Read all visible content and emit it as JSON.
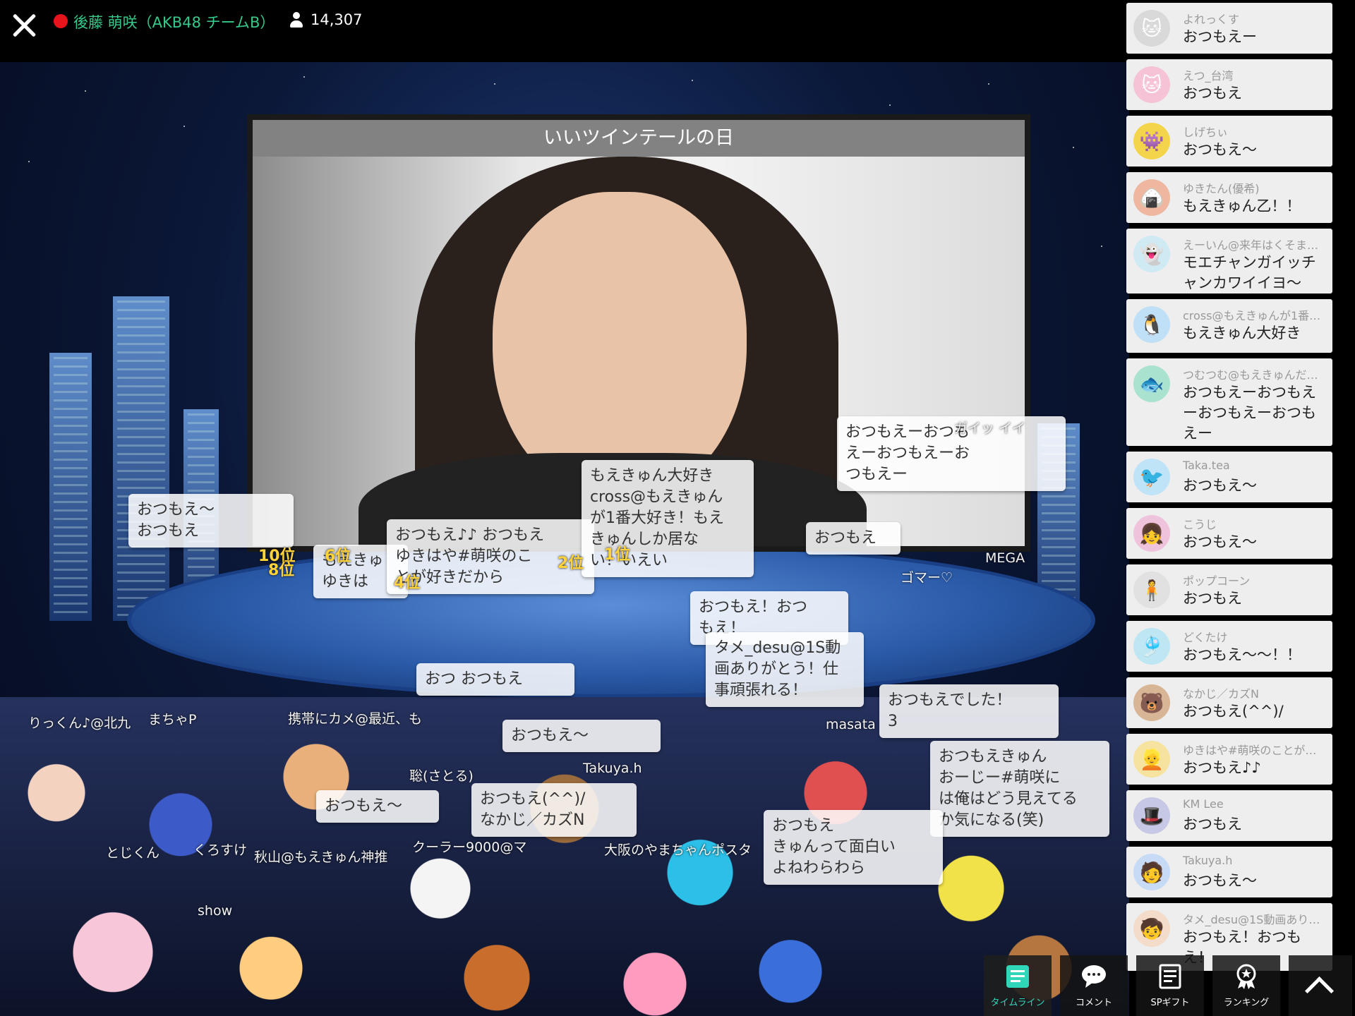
{
  "header": {
    "streamer": "後藤 萌咲（AKB48 チームB）",
    "viewers": "14,307"
  },
  "video": {
    "title": "いいツインテールの日"
  },
  "floating_comments": [
    {
      "text": "おつもえ〜\nおつもえ"
    },
    {
      "text": "もえきゅ\nゆきは"
    },
    {
      "text": "おつもえ♪♪ おつもえ\nゆきはや#萌咲のこ\nとが好きだから"
    },
    {
      "text": "もえきゅん大好き\ncross@もえきゅん\nが1番大好き！もえ\nきゅんしか居な\nい！いえい"
    },
    {
      "text": "おつもえーおつも\nえーおつもえーお\nつもえー"
    },
    {
      "text": "おつもえ"
    },
    {
      "text": "おつもえ！おつ\nもえ！"
    },
    {
      "text": "タメ_desu@1S動\n画ありがとう！仕\n事頑張れる！"
    },
    {
      "text": "おつ おつもえ"
    },
    {
      "text": "おつもえでした！\n3"
    },
    {
      "text": "おつもえ〜"
    },
    {
      "text": "おつもえきゅん\nおーじー#萌咲に\nは俺はどう見えてる\nか気になる(笑)"
    },
    {
      "text": "おつもえ〜"
    },
    {
      "text": "おつもえ(^^)/\nなかじ／カズN"
    },
    {
      "text": "おつもえ\nきゅんって面白い\nよねわらわら"
    }
  ],
  "floating_tags": [
    "りっくん♪@北九",
    "まちゃP",
    "携帯にカメ@最近、も",
    "聡(さとる)",
    "Takuya.h",
    "とじくん",
    "くろすけ",
    "秋山@もえきゅん神推",
    "クーラー9000@マ",
    "大阪のやまちゃんポスタ",
    "MEGA",
    "masata",
    "ゴマー♡",
    "ガイッ イイ",
    "show"
  ],
  "ranks": [
    "10位",
    "8位",
    "6位",
    "4位",
    "2位",
    "1位"
  ],
  "timeline": [
    {
      "user": "よれっくす",
      "message": "おつもえー",
      "avatar": "cat-avatar",
      "color": "#d9d9d9",
      "glyph": "🐱"
    },
    {
      "user": "えつ_台湾",
      "message": "おつもえ",
      "avatar": "pink-cat-avatar",
      "color": "#f6c3d6",
      "glyph": "🐱"
    },
    {
      "user": "しげちぃ",
      "message": "おつもえ〜",
      "avatar": "yellow-character-avatar",
      "color": "#f3d44a",
      "glyph": "👾"
    },
    {
      "user": "ゆきたん(優希)",
      "message": "もえきゅん乙！！",
      "avatar": "onigiri-avatar",
      "color": "#f0b7a0",
      "glyph": "🍙"
    },
    {
      "user": "えーいん@来年はくそま…",
      "message": "モエチャンガイッチャンカワイイヨ〜",
      "avatar": "ghost-avatar",
      "color": "#cfeaf2",
      "glyph": "👻"
    },
    {
      "user": "cross@もえきゅんが1番…",
      "message": "もえきゅん大好き",
      "avatar": "penguin-avatar",
      "color": "#bfe0f6",
      "glyph": "🐧"
    },
    {
      "user": "つむつむ@もえきゅんだ…",
      "message": "おつもえーおつもえーおつもえーおつもえー",
      "avatar": "fish-monster-avatar",
      "color": "#a9e3cf",
      "glyph": "🐟"
    },
    {
      "user": "Taka.tea",
      "message": "おつもえ〜",
      "avatar": "bird-avatar",
      "color": "#bfe3f7",
      "glyph": "🐦"
    },
    {
      "user": "こうじ",
      "message": "おつもえ〜",
      "avatar": "girl-avatar",
      "color": "#f0c3dc",
      "glyph": "👧"
    },
    {
      "user": "ポップコーン",
      "message": "おつもえ",
      "avatar": "boy-avatar",
      "color": "#e1e1e1",
      "glyph": "🧍"
    },
    {
      "user": "どくたけ",
      "message": "おつもえ〜〜！！",
      "avatar": "jellyfish-avatar",
      "color": "#bfe6f3",
      "glyph": "🎐"
    },
    {
      "user": "なかじ／カズN",
      "message": "おつもえ(^^)/",
      "avatar": "tanuki-avatar",
      "color": "#d8b594",
      "glyph": "🐻"
    },
    {
      "user": "ゆきはや#萌咲のことが…",
      "message": "おつもえ♪♪",
      "avatar": "blonde-girl-avatar",
      "color": "#f6e3a0",
      "glyph": "👱"
    },
    {
      "user": "KM Lee",
      "message": "おつもえ",
      "avatar": "magician-avatar",
      "color": "#c7c7e6",
      "glyph": "🎩"
    },
    {
      "user": "Takuya.h",
      "message": "おつもえ〜",
      "avatar": "blue-hair-avatar",
      "color": "#c7dbf6",
      "glyph": "🧑"
    },
    {
      "user": "タメ_desu@1S動画あり…",
      "message": "おつもえ！おつもえ！",
      "avatar": "chibi-avatar",
      "color": "#f3dcc9",
      "glyph": "🧒"
    }
  ],
  "nav": {
    "timeline": "タイムライン",
    "comment": "コメント",
    "sp_gift": "SPギフト",
    "ranking": "ランキング"
  }
}
